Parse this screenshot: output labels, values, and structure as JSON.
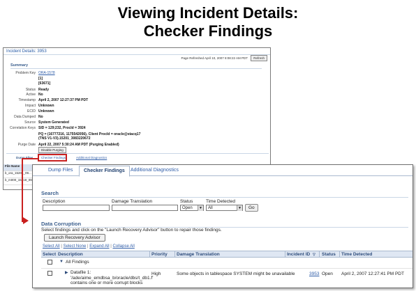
{
  "slide": {
    "title_line1": "Viewing Incident Details:",
    "title_line2": "Checker Findings"
  },
  "incident_details": {
    "header": "Incident Details: 3953",
    "page_refreshed": "Page Refreshed April 10, 2007 8:08:22 AM PDT",
    "refresh_label": "Refresh",
    "summary_label": "Summary",
    "fields": [
      {
        "key": "Problem Key",
        "value": "ORA-1578",
        "link": true
      },
      {
        "key": "",
        "value": "[1]"
      },
      {
        "key": "",
        "value": "[63671]"
      },
      {
        "key": "Status",
        "value": "Ready"
      },
      {
        "key": "Active",
        "value": "No"
      },
      {
        "key": "Timestamp",
        "value": "April 2, 2007 12:27:37 PM PDT"
      },
      {
        "key": "Impact",
        "value": "Unknown"
      },
      {
        "key": "ECID",
        "value": "Unknown"
      },
      {
        "key": "Data Dumped",
        "value": "No"
      },
      {
        "key": "Source",
        "value": "System Generated"
      },
      {
        "key": "Correlation Keys",
        "value": "SID = 129;232, ProcId = 3924"
      },
      {
        "key": "",
        "value": "PQ = (16777216, 1175542056), Client ProcId = oracle@stacq17"
      },
      {
        "key": "",
        "value": "(TNS V1-V3).15201_3083220672"
      },
      {
        "key": "Purge Date",
        "value": "April 22, 2007 5:30:24 AM PDT (Purging Enabled)"
      }
    ],
    "disable_purging_label": "Disable Purging",
    "tabs": {
      "dump": "Dump Files",
      "checker": "Checker Findings",
      "additional": "Additional Diagnostics"
    },
    "file_table": {
      "header": "File Name",
      "rows": [
        "b_ora_15201_09...",
        "b_m000_15318_09..."
      ]
    }
  },
  "checker_findings": {
    "tabs": [
      {
        "label": "Dump Files"
      },
      {
        "label": "Checker Findings"
      },
      {
        "label": "Additional Diagnostics"
      }
    ],
    "search": {
      "heading": "Search",
      "description_label": "Description",
      "damage_label": "Damage Translation",
      "status_label": "Status",
      "status_value": "Open",
      "time_label": "Time Detected",
      "time_value": "All",
      "go_label": "Go"
    },
    "corruption": {
      "heading": "Data Corruption",
      "instruction": "Select findings and click on the \"Launch Recovery Advisor\" button to repair those findings.",
      "launch_label": "Launch Recovery Advisor",
      "links": [
        "Select All",
        "Select None",
        "Expand All",
        "Collapse All"
      ]
    },
    "table": {
      "columns": [
        "Select",
        "Description",
        "Priority",
        "Damage Translation",
        "Incident ID",
        "Status",
        "Time Detected"
      ],
      "all_findings_label": "All Findings",
      "rows": [
        {
          "description_line1": "Datafile 1:",
          "description_line2": "'/ade/aime_emdbsa_b/oracle/dbs/t_db1.f'",
          "description_line3": "contains one or more corrupt blocks",
          "priority": "High",
          "damage": "Some objects in tablespace SYSTEM might be unavailable",
          "incident_id": "3953",
          "status": "Open",
          "time_detected": "April 2, 2007 12:27:41 PM PDT"
        }
      ]
    }
  },
  "colors": {
    "highlight_red": "#c9201f",
    "link_blue": "#2f5da8",
    "header_blue": "#3b5f8e"
  }
}
